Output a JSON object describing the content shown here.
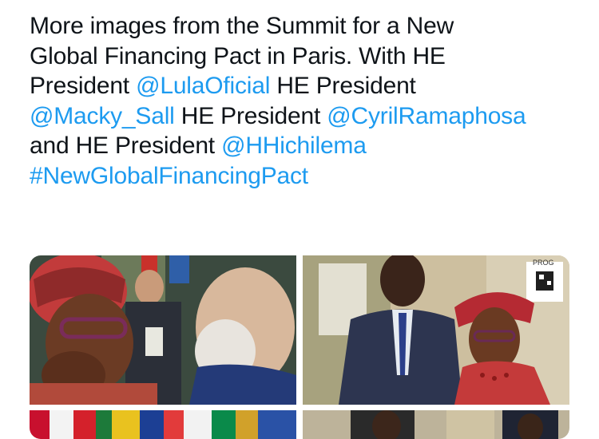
{
  "tweet": {
    "text_prefix": "More images from the Summit for a New",
    "line2": "Global Financing Pact in Paris. With HE",
    "line3_pre": "President ",
    "mention1": "@LulaOficial",
    "line3_post": " HE President",
    "mention2": "@Macky_Sall",
    "line4_mid": " HE President ",
    "mention3": "@CyrilRamaphosa",
    "line5_pre": "and HE President ",
    "mention4": "@HHichilema",
    "hashtag": "#NewGlobalFinancingPact"
  },
  "media": {
    "sign_text": "PROG",
    "photos": [
      {
        "name": "photo-embrace"
      },
      {
        "name": "photo-leaders-standing"
      },
      {
        "name": "photo-flags"
      },
      {
        "name": "photo-group"
      }
    ]
  },
  "colors": {
    "text": "#0f1419",
    "link": "#1d9bf0"
  }
}
